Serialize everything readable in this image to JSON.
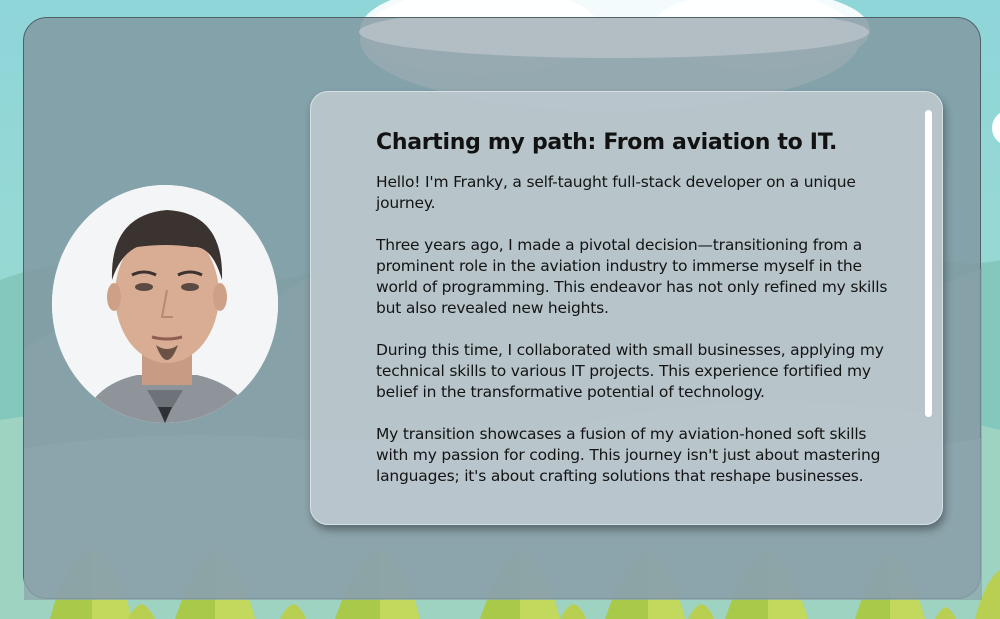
{
  "about": {
    "title": "Charting my path: From aviation to IT.",
    "paragraphs": [
      "Hello! I'm Franky, a self-taught full-stack developer on a unique journey.",
      "Three years ago, I made a pivotal decision—transitioning from a prominent role in the aviation industry to immerse myself in the world of programming. This endeavor has not only refined my skills but also revealed new heights.",
      "During this time, I collaborated with small businesses, applying my technical skills to various IT projects. This experience fortified my belief in the transformative potential of technology.",
      "My transition showcases a fusion of my aviation-honed soft skills with my passion for coding. This journey isn't just about mastering languages; it's about crafting solutions that reshape businesses."
    ]
  },
  "colors": {
    "sky": "#8fd6d9",
    "panel": "#8096a0",
    "card": "#bcc8ce",
    "tree_light": "#b9cf52",
    "tree_dark": "#8fb03a"
  }
}
